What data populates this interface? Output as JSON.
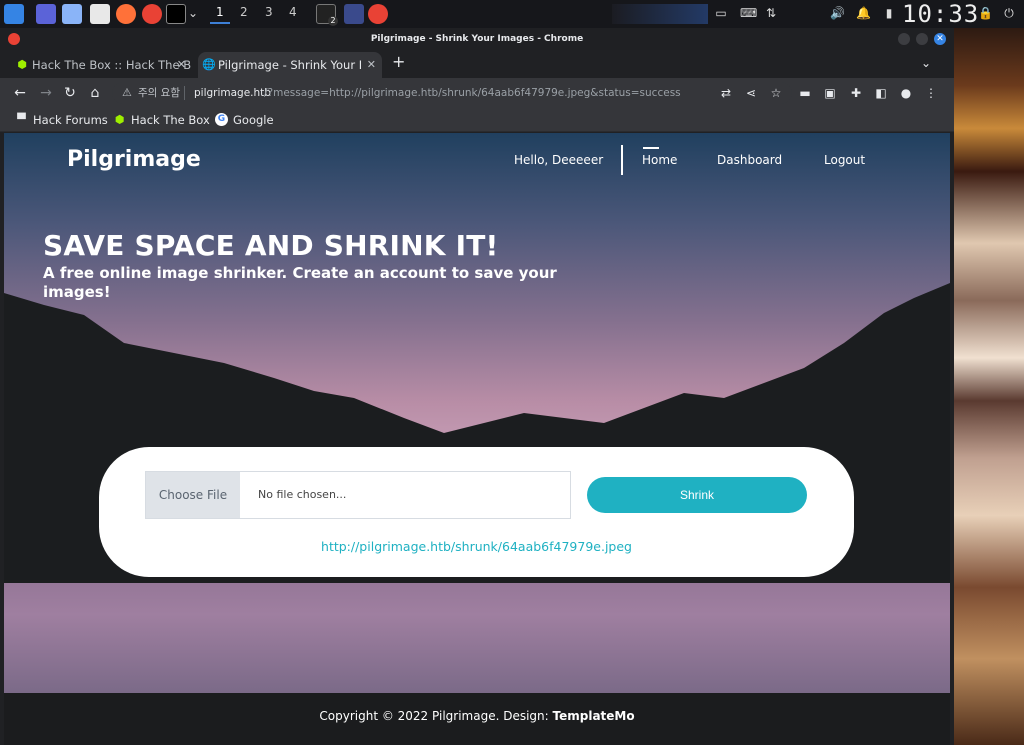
{
  "taskbar": {
    "workspaces": [
      "1",
      "2",
      "3",
      "4"
    ],
    "active_workspace": "1",
    "badge": "2",
    "clock": "10:33"
  },
  "browser": {
    "window_title": "Pilgrimage - Shrink Your Images - Chrome",
    "tabs": [
      {
        "label": "Hack The Box :: Hack The B",
        "active": false
      },
      {
        "label": "Pilgrimage - Shrink Your I",
        "active": true
      }
    ],
    "address": {
      "security_label": "주의 요함",
      "host": "pilgrimage.htb",
      "path": "/?message=http://pilgrimage.htb/shrunk/64aab6f47979e.jpeg&status=success"
    },
    "bookmarks": [
      "Hack Forums",
      "Hack The Box",
      "Google"
    ]
  },
  "page": {
    "brand": "Pilgrimage",
    "nav": {
      "greeting": "Hello, Deeeeer",
      "home": "Home",
      "dashboard": "Dashboard",
      "logout": "Logout"
    },
    "hero_title": "SAVE SPACE AND SHRINK IT!",
    "hero_subtitle": "A free online image shrinker. Create an account to save your images!",
    "upload": {
      "choose_file_label": "Choose File",
      "no_file_text": "No file chosen...",
      "shrink_label": "Shrink",
      "result_link": "http://pilgrimage.htb/shrunk/64aab6f47979e.jpeg"
    },
    "footer": {
      "prefix": "Copyright © 2022 Pilgrimage. Design: ",
      "designer": "TemplateMo"
    }
  },
  "colors": {
    "accent": "#1fb1c2",
    "chrome_dark": "#35363a"
  }
}
